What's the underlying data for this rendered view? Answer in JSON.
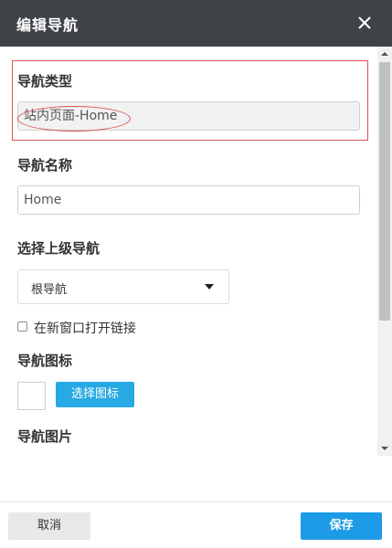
{
  "dialog": {
    "title": "编辑导航"
  },
  "form": {
    "nav_type": {
      "label": "导航类型",
      "value": "站内页面-Home"
    },
    "nav_name": {
      "label": "导航名称",
      "value": "Home"
    },
    "parent_nav": {
      "label": "选择上级导航",
      "selected": "根导航"
    },
    "open_new_window": {
      "label": "在新窗口打开链接",
      "checked": false
    },
    "nav_icon": {
      "label": "导航图标",
      "button_label": "选择图标"
    },
    "nav_image": {
      "label": "导航图片"
    }
  },
  "footer": {
    "cancel_label": "取消",
    "save_label": "保存"
  },
  "colors": {
    "header_bg": "#3f4347",
    "primary": "#1e9be6",
    "highlight_red": "#d9534f"
  }
}
